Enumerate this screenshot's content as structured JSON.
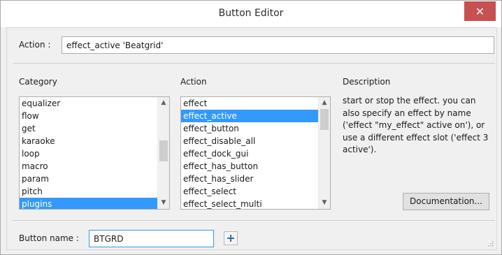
{
  "window": {
    "title": "Button Editor",
    "close_icon": "close-icon"
  },
  "action": {
    "label": "Action :",
    "value": "effect_active 'Beatgrid'"
  },
  "category": {
    "label": "Category",
    "items": [
      "equalizer",
      "flow",
      "get",
      "karaoke",
      "loop",
      "macro",
      "param",
      "pitch",
      "plugins"
    ],
    "selected_index": 8
  },
  "action_list": {
    "label": "Action",
    "items": [
      "effect",
      "effect_active",
      "effect_button",
      "effect_disable_all",
      "effect_dock_gui",
      "effect_has_button",
      "effect_has_slider",
      "effect_select",
      "effect_select_multi"
    ],
    "selected_index": 1
  },
  "description": {
    "label": "Description",
    "text": "start or stop the effect. you can also specify an effect by name ('effect \"my_effect\" active on'), or use a different effect slot ('effect 3 active')."
  },
  "documentation_button": "Documentation...",
  "button_name": {
    "label": "Button name :",
    "value": "BTGRD"
  },
  "colors": {
    "selection": "#3399ff",
    "close": "#c75050",
    "focus_border": "#3c9ad6"
  }
}
